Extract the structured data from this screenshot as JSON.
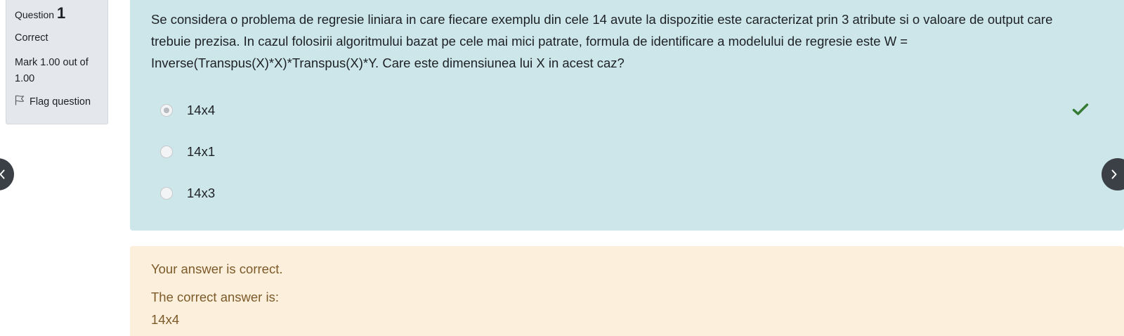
{
  "question_info": {
    "label": "Question",
    "number": "1",
    "state": "Correct",
    "grade": "Mark 1.00 out of 1.00",
    "flag_label": "Flag question"
  },
  "question": {
    "text": "Se considera o problema de regresie liniara in care fiecare exemplu din cele 14 avute la dispozitie este caracterizat prin 3 atribute si o valoare de output care trebuie prezisa. In cazul folosirii algoritmului bazat pe cele mai mici patrate, formula de identificare a modelului de regresie este W = Inverse(Transpus(X)*X)*Transpus(X)*Y. Care este dimensiunea lui X in acest caz?",
    "answers": [
      {
        "label": "14x4",
        "selected": true,
        "correct": true
      },
      {
        "label": "14x1",
        "selected": false,
        "correct": false
      },
      {
        "label": "14x3",
        "selected": false,
        "correct": false
      }
    ]
  },
  "feedback": {
    "specific": "Your answer is correct.",
    "right_answer_intro": "The correct answer is:",
    "right_answer": "14x4"
  },
  "icons": {
    "flag": "flag-icon",
    "check": "check-icon",
    "prev": "chevron-left-icon",
    "next": "chevron-right-icon"
  },
  "colors": {
    "info_bg": "#e4e7eb",
    "question_bg": "#cce6ea",
    "feedback_bg": "#fcefdc",
    "feedback_text": "#7d5a29",
    "check": "#357a32",
    "nav_button": "#3b4046"
  }
}
